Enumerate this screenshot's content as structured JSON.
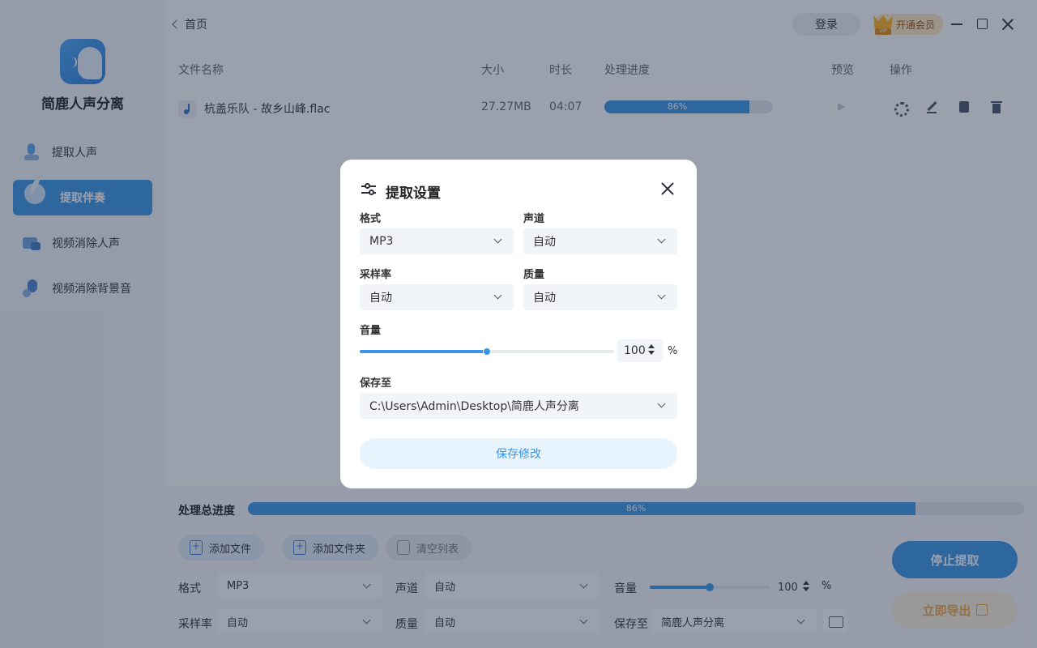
{
  "app": {
    "name": "简鹿人声分离"
  },
  "sidebar": {
    "items": [
      {
        "label": "提取人声",
        "icon": "mic-icon",
        "active": false
      },
      {
        "label": "提取伴奏",
        "icon": "guitar-icon",
        "active": true
      },
      {
        "label": "视频消除人声",
        "icon": "video-icon",
        "active": false
      },
      {
        "label": "视频消除背景音",
        "icon": "background-icon",
        "active": false
      }
    ]
  },
  "topbar": {
    "back_label": "首页",
    "login_label": "登录",
    "vip_label": "开通会员"
  },
  "table": {
    "columns": [
      "文件名称",
      "大小",
      "时长",
      "处理进度",
      "预览",
      "操作"
    ],
    "rows": [
      {
        "name": "杭盖乐队 - 故乡山峰.flac",
        "size": "27.27MB",
        "duration": "04:07",
        "progress_label": "86%",
        "progress": 0.86
      }
    ]
  },
  "bottom": {
    "total_label": "处理总进度",
    "total_progress_label": "86%",
    "total_progress": 0.86,
    "add_file": "添加文件",
    "add_folder": "添加文件夹",
    "clear_list": "清空列表",
    "format_label": "格式",
    "format_value": "MP3",
    "channel_label": "声道",
    "channel_value": "自动",
    "volume_label": "音量",
    "volume_value": "100",
    "volume_unit": "%",
    "volume_level": 0.5,
    "samplerate_label": "采样率",
    "samplerate_value": "自动",
    "quality_label": "质量",
    "quality_value": "自动",
    "save_to_label": "保存至",
    "save_to_value": "简鹿人声分离",
    "stop_label": "停止提取",
    "export_label": "立即导出"
  },
  "modal": {
    "title": "提取设置",
    "format_label": "格式",
    "format_value": "MP3",
    "channel_label": "声道",
    "channel_value": "自动",
    "samplerate_label": "采样率",
    "samplerate_value": "自动",
    "quality_label": "质量",
    "quality_value": "自动",
    "volume_label": "音量",
    "volume_value": "100",
    "volume_unit": "%",
    "volume_level": 0.5,
    "save_to_label": "保存至",
    "save_to_value": "C:\\Users\\Admin\\Desktop\\简鹿人声分离",
    "save_button": "保存修改"
  },
  "colors": {
    "accent": "#3b95e6",
    "overlay": "rgba(30,45,70,0.45)",
    "vip": "#ffe9bf"
  }
}
